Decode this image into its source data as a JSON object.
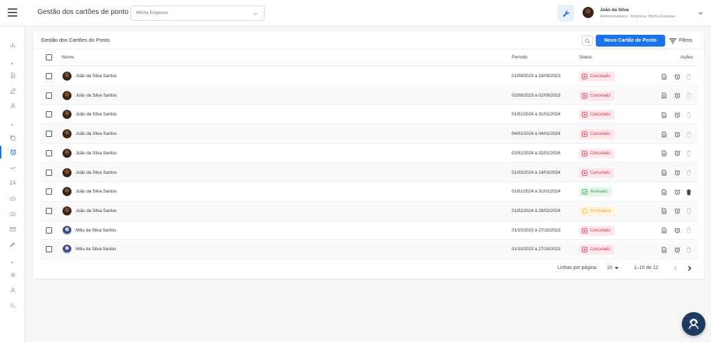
{
  "header": {
    "app_title": "Gestão dos cartões de ponto",
    "company_select": {
      "value": "Minha Empresa"
    },
    "user": {
      "name": "João da Silva",
      "role": "Administradores - Empresa: Minha Empresa"
    }
  },
  "sidebar": {
    "icons": [
      "bar-chart-icon",
      "document-icon",
      "pen-icon",
      "user-icon",
      "copy-icon",
      "alarm-clock-icon",
      "trend-icon",
      "chat-icon",
      "cloud-upload-icon",
      "cloud-download-icon",
      "mail-icon",
      "wrench-icon",
      "gear-icon",
      "user-icon",
      "list-check-icon"
    ],
    "active": "alarm-clock-icon"
  },
  "card": {
    "title": "Gestão dos Cartões do Ponto",
    "new_button": "Novo Cartão de Ponto",
    "filter_button": "Filtros"
  },
  "table": {
    "headers": {
      "name": "Nome",
      "period": "Período",
      "status": "Status",
      "actions": "Ações"
    },
    "rows": [
      {
        "name": "João da Silva Santos",
        "period": "01/09/2023 à 19/09/2023",
        "status": "Cancelado",
        "status_type": "cancel"
      },
      {
        "name": "João da Silva Santos",
        "period": "02/09/2023 à 02/09/2023",
        "status": "Cancelado",
        "status_type": "cancel"
      },
      {
        "name": "João da Silva Santos",
        "period": "01/01/2024 à 31/01/2024",
        "status": "Cancelado",
        "status_type": "cancel"
      },
      {
        "name": "João da Silva Santos",
        "period": "04/01/2024 à 04/01/2024",
        "status": "Cancelado",
        "status_type": "cancel"
      },
      {
        "name": "João da Silva Santos",
        "period": "02/01/2024 à 02/01/2024",
        "status": "Cancelado",
        "status_type": "cancel"
      },
      {
        "name": "João da Silva Santos",
        "period": "01/03/2024 à 14/03/2024",
        "status": "Cancelado",
        "status_type": "cancel"
      },
      {
        "name": "João da Silva Santos",
        "period": "01/01/2024 à 31/01/2024",
        "status": "Assinado",
        "status_type": "signed"
      },
      {
        "name": "João da Silva Santos",
        "period": "01/02/2024 à 29/02/2024",
        "status": "Em Análise",
        "status_type": "review"
      },
      {
        "name": "Miliu da Silva Santos",
        "period": "01/10/2023 à 27/10/2023",
        "status": "Cancelado",
        "status_type": "cancel"
      },
      {
        "name": "Miliu da Silva Santos",
        "period": "01/10/2023 à 27/10/2023",
        "status": "Cancelado",
        "status_type": "cancel"
      }
    ]
  },
  "pagination": {
    "rows_per_page_label": "Linhas por página:",
    "rows_per_page": "10",
    "range": "1–10 de 12"
  },
  "colors": {
    "primary": "#1a73e8",
    "cancel": "#d0354f",
    "signed": "#2e9b4a",
    "review": "#e8a020",
    "fab": "#1e3a5f"
  }
}
